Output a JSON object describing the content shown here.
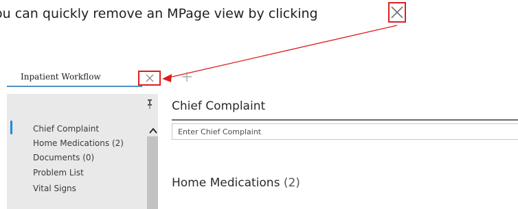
{
  "instruction": {
    "text": "ou can quickly remove an MPage view by clicking"
  },
  "tabs": {
    "active_label": "Inpatient Workflow"
  },
  "sidebar": {
    "items": [
      {
        "label": "Chief Complaint",
        "active": true
      },
      {
        "label": "Home Medications (2)"
      },
      {
        "label": "Documents (0)"
      },
      {
        "label": "Problem List"
      },
      {
        "label": "Vital Signs"
      }
    ]
  },
  "main": {
    "chief_complaint": {
      "title": "Chief Complaint",
      "placeholder": "Enter Chief Complaint"
    },
    "home_medications": {
      "title": "Home Medications",
      "count": "(2)"
    }
  },
  "colors": {
    "callout_red": "#e01b1b",
    "accent_blue": "#1e88d8",
    "tab_underline": "#4a90c8",
    "sidebar_bg": "#e9e9e9"
  },
  "icons": [
    "close-icon",
    "plus-icon",
    "pin-icon",
    "chevron-up-icon"
  ]
}
